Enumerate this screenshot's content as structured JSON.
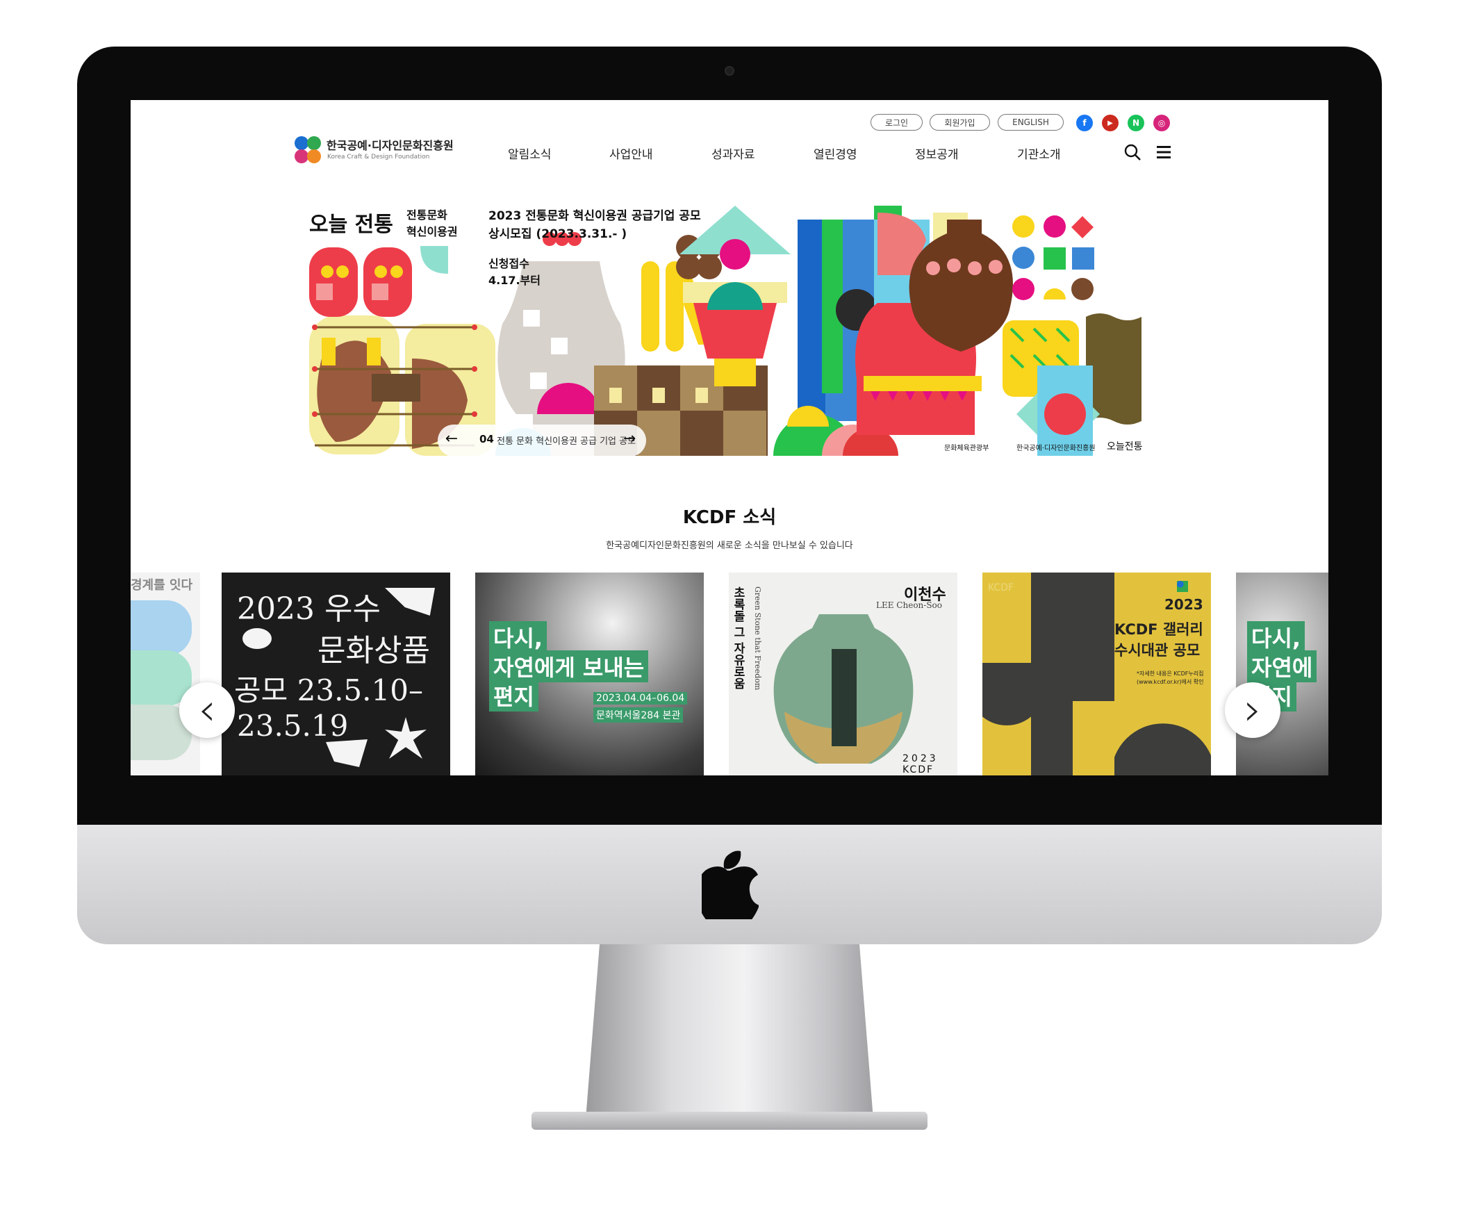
{
  "utility": {
    "login": "로그인",
    "signup": "회원가입",
    "english": "ENGLISH"
  },
  "sns": [
    {
      "name": "facebook-icon",
      "glyph": "f",
      "color": "#1877f2"
    },
    {
      "name": "youtube-icon",
      "glyph": "▶",
      "color": "#cc2a1e"
    },
    {
      "name": "naver-icon",
      "glyph": "N",
      "color": "#19c35a"
    },
    {
      "name": "instagram-icon",
      "glyph": "◎",
      "color": "#d6247b"
    }
  ],
  "logo": {
    "ko": "한국공예·디자인문화진흥원",
    "en": "Korea Craft & Design Foundation"
  },
  "gnb": [
    "알림소식",
    "사업안내",
    "성과자료",
    "열린경영",
    "정보공개",
    "기관소개"
  ],
  "banner": {
    "title": "오늘 전통",
    "subtitle": "전통문화\n혁신이용권",
    "headline": "2023 전통문화 혁신이용권 공급기업 공모\n상시모집 (2023.3.31.- )",
    "apply": "신청접수\n4.17.부터",
    "footer_ministry": "문화체육관광부",
    "footer_kcdf": "한국공예·디자인문화진흥원",
    "footer_brand": "오늘전통",
    "pager_num": "04",
    "pager_label": "전통 문화 혁신이용권 공급 기업 공모",
    "prev_arrow": "←",
    "next_arrow": "→"
  },
  "news": {
    "title": "KCDF 소식",
    "desc": "한국공예디자인문화진흥원의 새로운 소식을 만나보실 수 있습니다",
    "cards": [
      {
        "text": "경계를 잇다"
      },
      {
        "line1": "2023 우수",
        "line2": "문화상품",
        "line3": "공모 23.5.10–",
        "line4": "23.5.19"
      },
      {
        "line1": "다시,",
        "line2": "자연에게 보내는",
        "line3": "편지",
        "date": "2023.04.04–06.04",
        "venue": "문화역서울284 본관"
      },
      {
        "artist": "이천수",
        "artist_en": "LEE Cheon-Soo",
        "vertical": "초록돌 그 자유로움",
        "vertical_en": "Green Stone that Freedom",
        "year": "2023",
        "brand": "KCDF"
      },
      {
        "year": "2023",
        "title1": "KCDF 갤러리",
        "title2": "수시대관 공모",
        "note1": "*자세한 내용은 KCDF누리집",
        "note2": "(www.kcdf.or.kr)에서 확인",
        "pattern": "KCDF"
      },
      {
        "line1": "다시,",
        "line2": "자연에",
        "line3": "편지"
      }
    ],
    "prev": "‹",
    "next": "›"
  },
  "colors": {
    "kcdf_green": "#3a9a6a",
    "kcdf_yellow": "#e2c23d"
  }
}
